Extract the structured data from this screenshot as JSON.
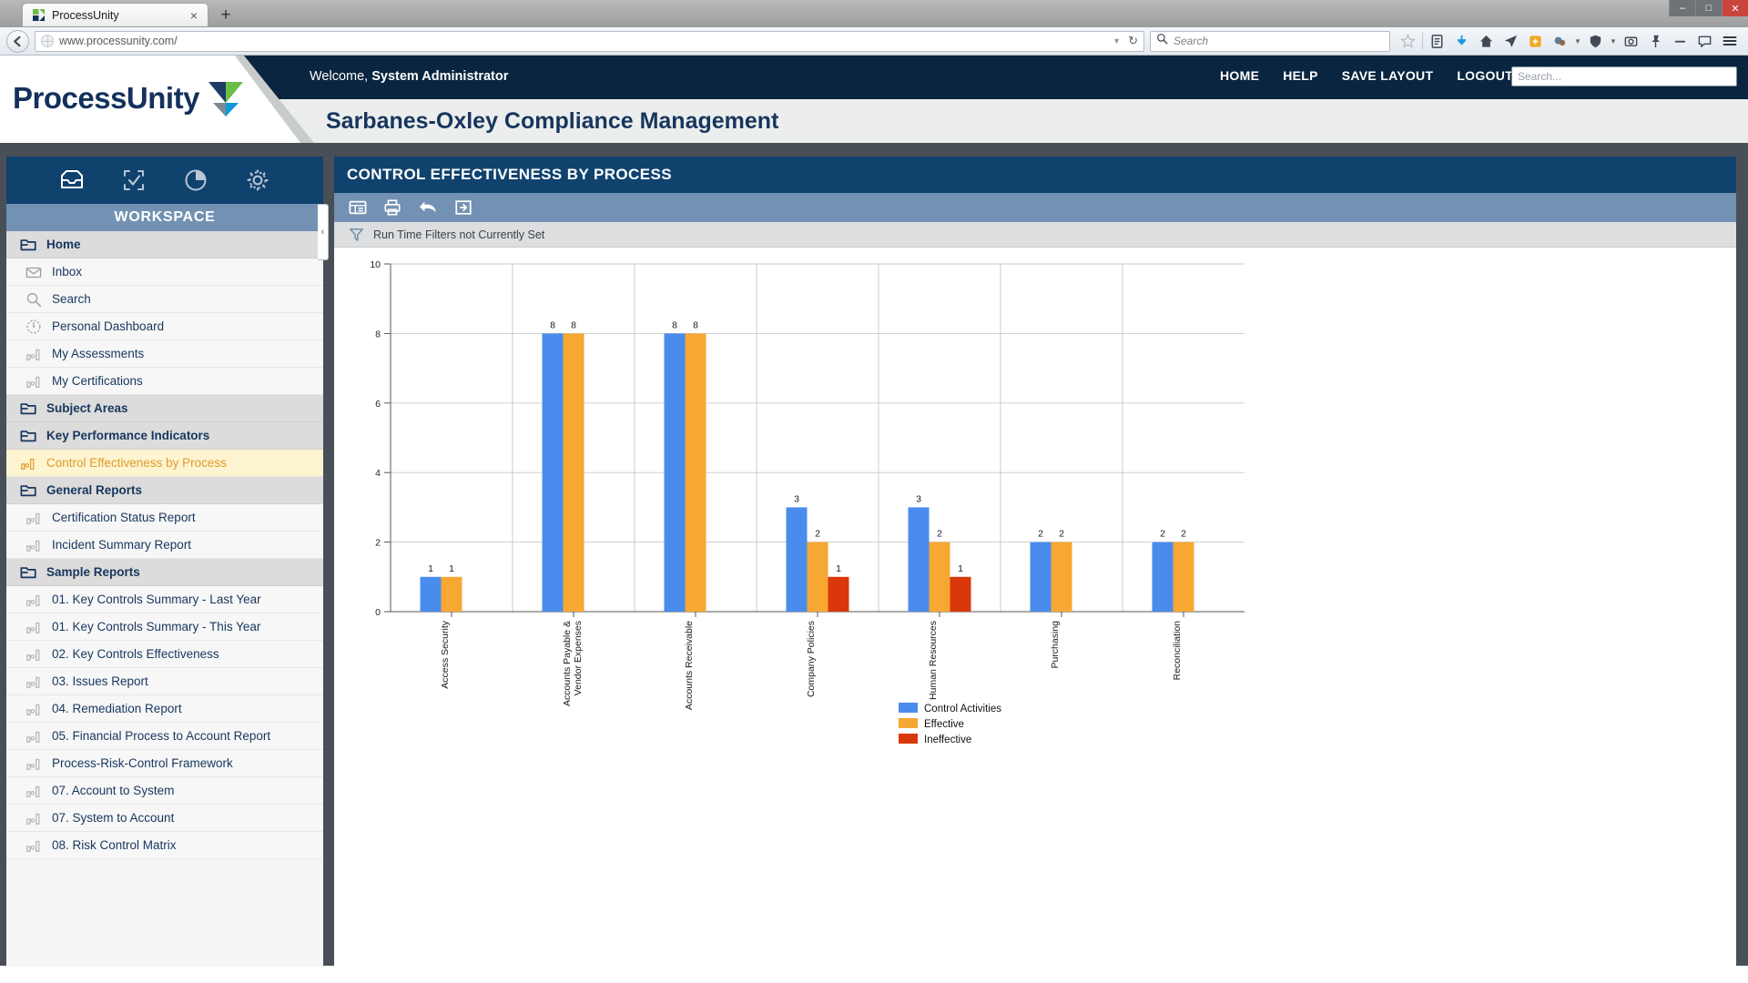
{
  "browser": {
    "tab": {
      "title": "ProcessUnity",
      "favicon": "processunity-favicon",
      "close": "×"
    },
    "newtab_label": "+",
    "window_controls": {
      "minimize": "–",
      "maximize": "□",
      "close": "✕"
    },
    "url": "www.processunity.com/",
    "url_dropdown_caret": "▼",
    "reload": "↻",
    "search_placeholder": "Search",
    "toolbar_icons": [
      "bookmark-star-icon",
      "reader-list-icon",
      "download-arrow-icon",
      "home-icon",
      "send-tab-icon",
      "extension-puzzle-icon",
      "addon-icon",
      "caret-down-icon",
      "shield-icon",
      "caret-down-icon-2",
      "screenshot-icon",
      "pin-icon",
      "minus-icon",
      "chat-icon",
      "hamburger-menu-icon"
    ]
  },
  "header": {
    "logo_text": "ProcessUnity",
    "welcome_prefix": "Welcome,",
    "welcome_user": "System Administrator",
    "nav": [
      {
        "label": "HOME"
      },
      {
        "label": "HELP"
      },
      {
        "label": "SAVE LAYOUT"
      },
      {
        "label": "LOGOUT"
      }
    ],
    "search_placeholder": "Search...",
    "page_title": "Sarbanes-Oxley Compliance Management"
  },
  "sidebar": {
    "top_icons": [
      {
        "name": "inbox-tray-icon"
      },
      {
        "name": "task-check-icon"
      },
      {
        "name": "pie-chart-icon"
      },
      {
        "name": "gear-icon"
      }
    ],
    "section_title": "WORKSPACE",
    "collapse_glyph": "‹",
    "items": [
      {
        "label": "Home",
        "icon": "folder-icon",
        "type": "group"
      },
      {
        "label": "Inbox",
        "icon": "envelope-icon",
        "type": "child"
      },
      {
        "label": "Search",
        "icon": "magnifier-icon",
        "type": "child"
      },
      {
        "label": "Personal Dashboard",
        "icon": "gauge-icon",
        "type": "child"
      },
      {
        "label": "My Assessments",
        "icon": "bar-chart-icon",
        "type": "child"
      },
      {
        "label": "My Certifications",
        "icon": "bar-chart-icon",
        "type": "child"
      },
      {
        "label": "Subject Areas",
        "icon": "folder-icon",
        "type": "group"
      },
      {
        "label": "Key Performance Indicators",
        "icon": "folder-icon",
        "type": "group"
      },
      {
        "label": "Control Effectiveness by Process",
        "icon": "bar-chart-icon",
        "type": "active"
      },
      {
        "label": "General Reports",
        "icon": "folder-icon",
        "type": "group"
      },
      {
        "label": "Certification Status Report",
        "icon": "bar-chart-icon",
        "type": "child"
      },
      {
        "label": "Incident Summary Report",
        "icon": "bar-chart-icon",
        "type": "child"
      },
      {
        "label": "Sample Reports",
        "icon": "folder-icon",
        "type": "group"
      },
      {
        "label": "01. Key Controls Summary - Last Year",
        "icon": "bar-chart-icon",
        "type": "child"
      },
      {
        "label": "01. Key Controls Summary - This Year",
        "icon": "bar-chart-icon",
        "type": "child"
      },
      {
        "label": "02. Key Controls Effectiveness",
        "icon": "bar-chart-icon",
        "type": "child"
      },
      {
        "label": "03. Issues Report",
        "icon": "bar-chart-icon",
        "type": "child"
      },
      {
        "label": "04. Remediation Report",
        "icon": "bar-chart-icon",
        "type": "child"
      },
      {
        "label": "05. Financial Process to Account Report",
        "icon": "bar-chart-icon",
        "type": "child"
      },
      {
        "label": "Process-Risk-Control Framework",
        "icon": "bar-chart-icon",
        "type": "child"
      },
      {
        "label": "07. Account to System",
        "icon": "bar-chart-icon",
        "type": "child"
      },
      {
        "label": "07. System to Account",
        "icon": "bar-chart-icon",
        "type": "child"
      },
      {
        "label": "08. Risk Control Matrix",
        "icon": "bar-chart-icon",
        "type": "child"
      }
    ]
  },
  "main": {
    "title": "CONTROL EFFECTIVENESS BY PROCESS",
    "toolbar": [
      {
        "name": "table-view-icon"
      },
      {
        "name": "print-icon"
      },
      {
        "name": "undo-arrow-icon"
      },
      {
        "name": "export-next-icon"
      }
    ],
    "filter_icon": "funnel-filter-icon",
    "filter_text": "Run Time Filters not Currently Set"
  },
  "chart_data": {
    "type": "bar",
    "title": "",
    "xlabel": "",
    "ylabel": "",
    "ylim": [
      0,
      10
    ],
    "yticks": [
      0,
      2,
      4,
      6,
      8,
      10
    ],
    "grid": true,
    "legend_position": "bottom-center",
    "colors": {
      "control_activities": "#4a8ced",
      "effective": "#f6a833",
      "ineffective": "#d9380b"
    },
    "categories": [
      "Access Security",
      "Accounts Payable & Vendor Expenses",
      "Accounts Receivable",
      "Company Policies",
      "Human Resources",
      "Purchasing",
      "Reconciliation"
    ],
    "series": [
      {
        "name": "Control Activities",
        "color": "#4a8ced",
        "values": [
          1,
          8,
          8,
          3,
          3,
          2,
          2
        ]
      },
      {
        "name": "Effective",
        "color": "#f6a833",
        "values": [
          1,
          8,
          8,
          2,
          2,
          2,
          2
        ]
      },
      {
        "name": "Ineffective",
        "color": "#d9380b",
        "values": [
          null,
          null,
          null,
          1,
          1,
          null,
          null
        ]
      }
    ]
  }
}
